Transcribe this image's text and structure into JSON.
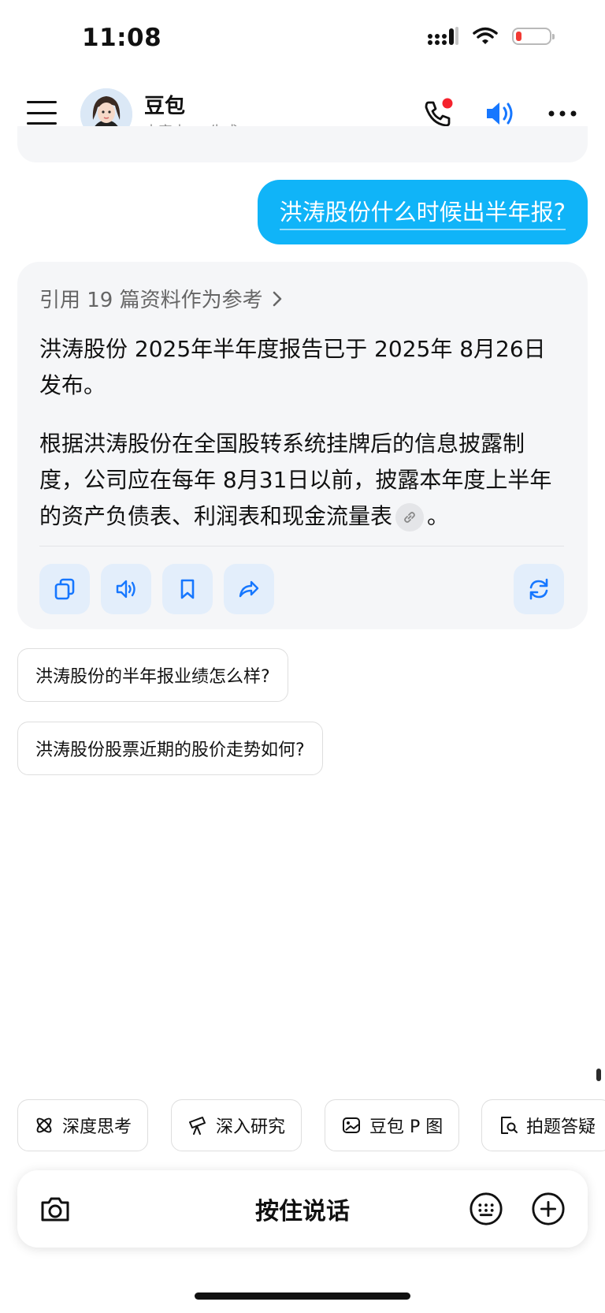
{
  "status_bar": {
    "time": "11:08"
  },
  "header": {
    "bot_name": "豆包",
    "bot_subtitle": "内容由 AI 生成",
    "icons": [
      "menu-icon",
      "phone-icon",
      "speaker-icon",
      "more-icon"
    ],
    "accent_color": "#1677ff",
    "notification_color": "#f5222d"
  },
  "chat": {
    "user_message": "洪涛股份什么时候出半年报?",
    "answer": {
      "references": "引用 19 篇资料作为参考",
      "paragraph1": "洪涛股份 2025年半年度报告已于 2025年 8月26日发布。",
      "paragraph2": "根据洪涛股份在全国股转系统挂牌后的信息披露制度，公司应在每年 8月31日以前，披露本年度上半年的资产负债表、利润表和现金流量表",
      "paragraph2_end": "。",
      "actions": [
        "copy-icon",
        "read-aloud-icon",
        "bookmark-icon",
        "share-icon",
        "regenerate-icon"
      ]
    },
    "suggestions": [
      "洪涛股份的半年报业绩怎么样?",
      "洪涛股份股票近期的股价走势如何?"
    ]
  },
  "tools": [
    {
      "label": "深度思考",
      "icon": "atom-icon"
    },
    {
      "label": "深入研究",
      "icon": "telescope-icon"
    },
    {
      "label": "豆包 P 图",
      "icon": "image-edit-icon"
    },
    {
      "label": "拍题答疑",
      "icon": "scan-question-icon"
    }
  ],
  "input": {
    "hold_to_talk": "按住说话"
  },
  "colors": {
    "user_bubble": "#10b4f8",
    "card_bg": "#f5f6f8",
    "action_bg": "#e3eefb"
  }
}
